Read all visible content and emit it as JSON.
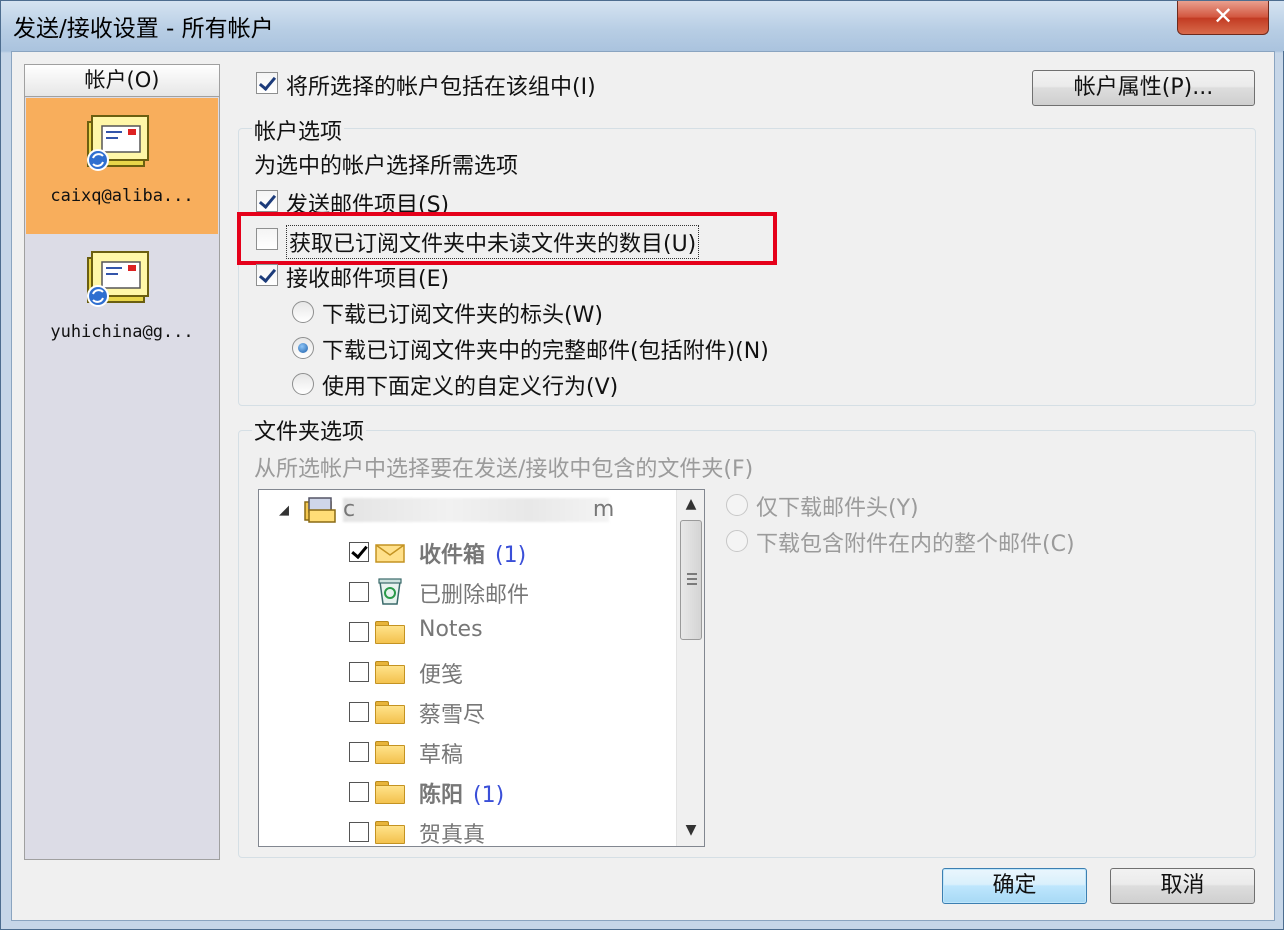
{
  "window": {
    "title": "发送/接收设置 - 所有帐户",
    "close_label": "✕"
  },
  "accounts": {
    "header": "帐户(O)",
    "items": [
      {
        "label": "caixq@aliba...",
        "selected": true
      },
      {
        "label": "yuhichina@g...",
        "selected": false
      }
    ]
  },
  "include_checkbox": {
    "label": "将所选择的帐户包括在该组中(I)",
    "checked": true
  },
  "account_properties_button": "帐户属性(P)...",
  "account_options": {
    "title": "帐户选项",
    "description": "为选中的帐户选择所需选项",
    "send_items": {
      "label": "发送邮件项目(S)",
      "checked": true
    },
    "unread_count": {
      "label": "获取已订阅文件夹中未读文件夹的数目(U)",
      "checked": false,
      "highlighted": true
    },
    "receive_items": {
      "label": "接收邮件项目(E)",
      "checked": true
    },
    "radio_options": [
      {
        "label": "下载已订阅文件夹的标头(W)",
        "selected": false
      },
      {
        "label": "下载已订阅文件夹中的完整邮件(包括附件)(N)",
        "selected": true
      },
      {
        "label": "使用下面定义的自定义行为(V)",
        "selected": false
      }
    ]
  },
  "folder_options": {
    "title": "文件夹选项",
    "description": "从所选帐户中选择要在发送/接收中包含的文件夹(F)",
    "account_root": "c                                  m",
    "folders": [
      {
        "name": "收件箱",
        "count": "(1)",
        "checked": true,
        "bold": true,
        "icon": "inbox-icon"
      },
      {
        "name": "已删除邮件",
        "count": "",
        "checked": false,
        "bold": false,
        "icon": "recycle-icon"
      },
      {
        "name": "Notes",
        "count": "",
        "checked": false,
        "bold": false,
        "icon": "folder-icon"
      },
      {
        "name": "便笺",
        "count": "",
        "checked": false,
        "bold": false,
        "icon": "folder-icon"
      },
      {
        "name": "蔡雪尽",
        "count": "",
        "checked": false,
        "bold": false,
        "icon": "folder-icon"
      },
      {
        "name": "草稿",
        "count": "",
        "checked": false,
        "bold": false,
        "icon": "folder-icon"
      },
      {
        "name": "陈阳",
        "count": "(1)",
        "checked": false,
        "bold": true,
        "icon": "folder-icon"
      },
      {
        "name": "贺真真",
        "count": "",
        "checked": false,
        "bold": false,
        "icon": "folder-icon"
      }
    ],
    "download_options": [
      {
        "label": "仅下载邮件头(Y)",
        "selected": false
      },
      {
        "label": "下载包含附件在内的整个邮件(C)",
        "selected": false
      }
    ]
  },
  "buttons": {
    "ok": "确定",
    "cancel": "取消"
  }
}
